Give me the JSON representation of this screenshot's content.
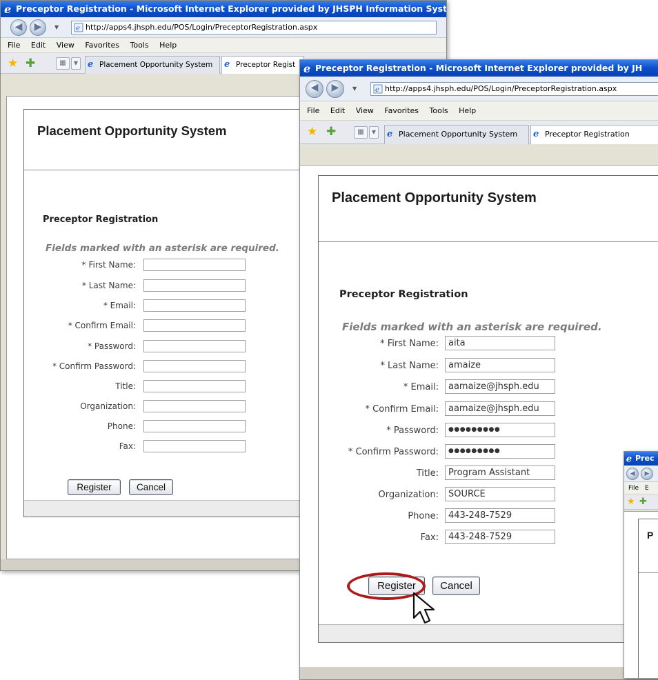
{
  "ie_title": "Preceptor Registration - Microsoft Internet Explorer provided by JHSPH Information Systems",
  "ie_title_cut2": "Preceptor Registration - Microsoft Internet Explorer provided by JH",
  "ie_title_cut3": "Prec",
  "address": "http://apps4.jhsph.edu/POS/Login/PreceptorRegistration.aspx",
  "menu": {
    "file": "File",
    "edit": "Edit",
    "view": "View",
    "favorites": "Favorites",
    "tools": "Tools",
    "help": "Help",
    "edit_cut": "E"
  },
  "tabs": {
    "placement": "Placement Opportunity System",
    "preceptor": "Preceptor Registration",
    "preceptor_cut": "Preceptor Regist"
  },
  "app_title": "Placement Opportunity System",
  "app_title_cut": "P",
  "page_heading": "Preceptor Registration",
  "required_note": "Fields marked with an asterisk are required.",
  "fields": {
    "first_name": {
      "label": "* First Name:",
      "value": "aita"
    },
    "last_name": {
      "label": "* Last Name:",
      "value": "amaize"
    },
    "email": {
      "label": "* Email:",
      "value": "aamaize@jhsph.edu"
    },
    "confirm_email": {
      "label": "* Confirm Email:",
      "value": "aamaize@jhsph.edu"
    },
    "password": {
      "label": "* Password:",
      "value": "●●●●●●●●●"
    },
    "confirm_password": {
      "label": "* Confirm Password:",
      "value": "●●●●●●●●●"
    },
    "title": {
      "label": "Title:",
      "value": "Program Assistant"
    },
    "organization": {
      "label": "Organization:",
      "value": "SOURCE"
    },
    "phone": {
      "label": "Phone:",
      "value": "443-248-7529"
    },
    "fax": {
      "label": "Fax:",
      "value": "443-248-7529"
    }
  },
  "buttons": {
    "register": "Register",
    "cancel": "Cancel"
  },
  "colors": {
    "titlebar": "#0a4fc9",
    "highlight_ring": "#b01919"
  },
  "icons": [
    "ie-icon",
    "back-icon",
    "forward-icon",
    "page-icon",
    "favorites-star-icon",
    "add-favorites-icon",
    "quick-tabs-icon",
    "cursor-icon"
  ]
}
